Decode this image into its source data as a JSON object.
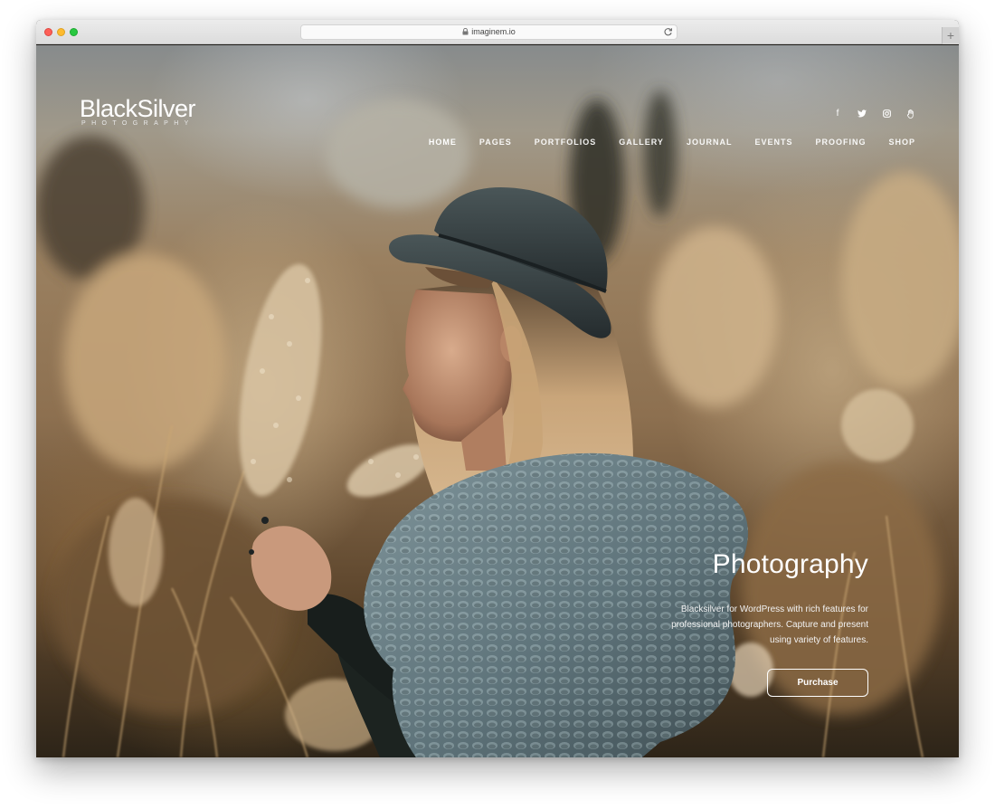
{
  "browser": {
    "url": "imaginem.io"
  },
  "site": {
    "logo_main": "BlackSilver",
    "logo_sub": "PHOTOGRAPHY"
  },
  "social": [
    {
      "icon": "facebook-icon",
      "glyph": "f"
    },
    {
      "icon": "twitter-icon",
      "glyph": "🐦"
    },
    {
      "icon": "instagram-icon",
      "glyph": "◎"
    },
    {
      "icon": "hand-icon",
      "glyph": "✋"
    }
  ],
  "nav": {
    "items": [
      "HOME",
      "PAGES",
      "PORTFOLIOS",
      "GALLERY",
      "JOURNAL",
      "EVENTS",
      "PROOFING",
      "SHOP"
    ],
    "active": "HOME"
  },
  "hero": {
    "title": "Photography",
    "text": "Blacksilver for WordPress with rich features for professional photographers. Capture and present using variety of features.",
    "button_label": "Purchase"
  },
  "colors": {
    "chrome": "#e3e3e3",
    "hero_tone": "#8d7050",
    "text": "#ffffff"
  }
}
